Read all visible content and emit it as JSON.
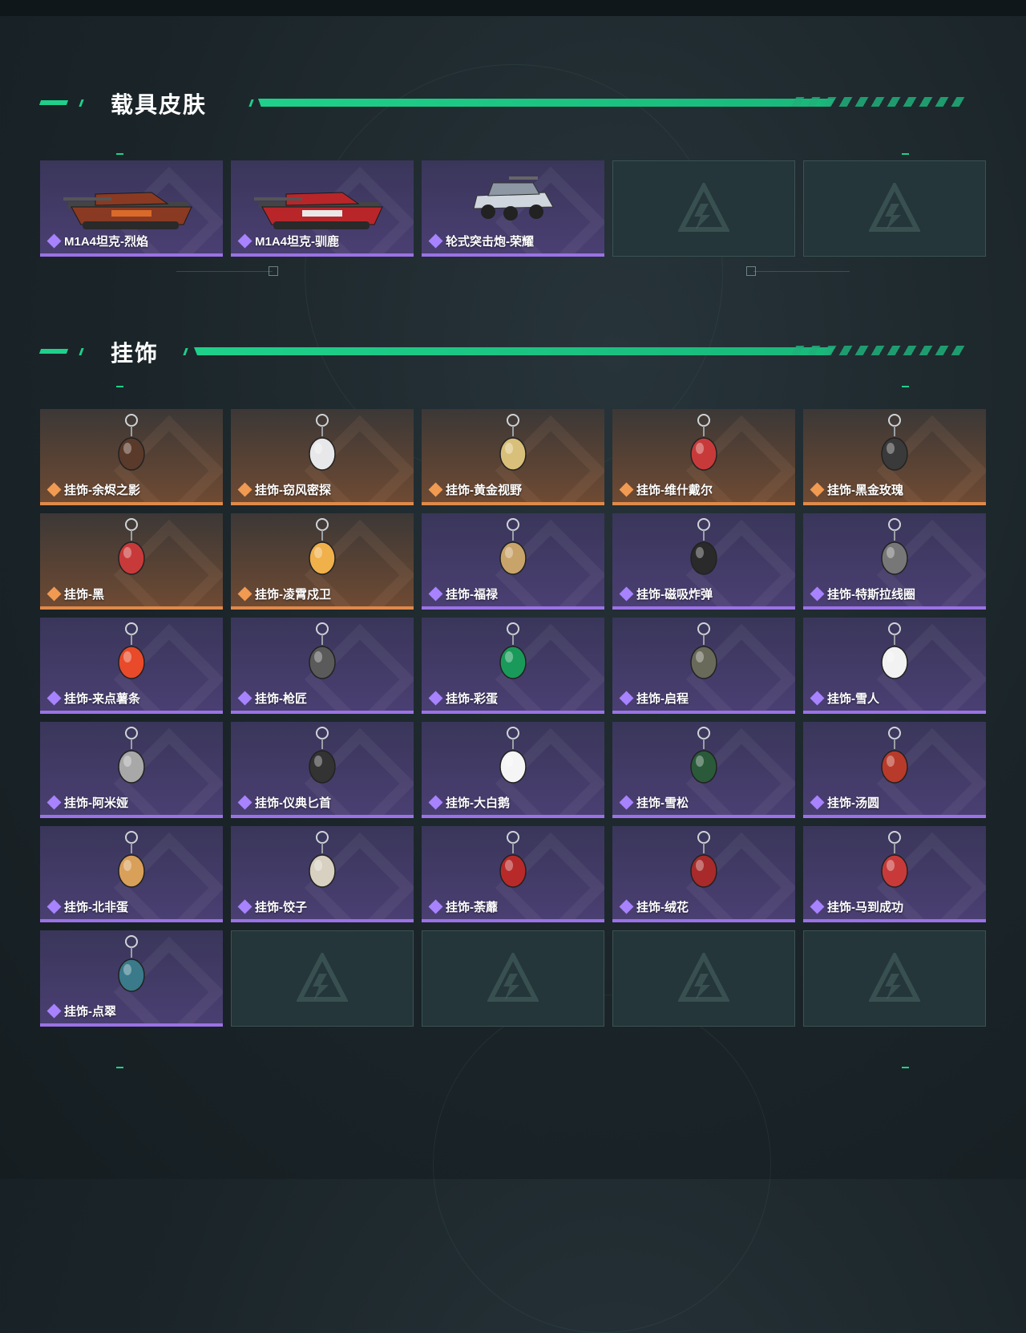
{
  "sections": {
    "vehicle_skins": {
      "title": "载具皮肤",
      "items": [
        {
          "label": "M1A4坦克-烈焰",
          "rarity": "purple",
          "icon": "tank-flame-icon"
        },
        {
          "label": "M1A4坦克-驯鹿",
          "rarity": "purple",
          "icon": "tank-reindeer-icon"
        },
        {
          "label": "轮式突击炮-荣耀",
          "rarity": "purple",
          "icon": "wheeled-assault-gun-icon"
        }
      ]
    },
    "charms": {
      "title": "挂饰",
      "items": [
        {
          "label": "挂饰-余烬之影",
          "rarity": "orange",
          "icon": "ember-shadow-charm-icon"
        },
        {
          "label": "挂饰-窃风密探",
          "rarity": "orange",
          "icon": "wind-spy-charm-icon"
        },
        {
          "label": "挂饰-黄金视野",
          "rarity": "orange",
          "icon": "golden-vision-charm-icon"
        },
        {
          "label": "挂饰-维什戴尔",
          "rarity": "orange",
          "icon": "wisdel-charm-icon"
        },
        {
          "label": "挂饰-黑金玫瑰",
          "rarity": "orange",
          "icon": "black-gold-rose-charm-icon"
        },
        {
          "label": "挂饰-黑",
          "rarity": "orange",
          "icon": "hei-charm-icon"
        },
        {
          "label": "挂饰-凌霄戍卫",
          "rarity": "orange",
          "icon": "sky-guard-charm-icon"
        },
        {
          "label": "挂饰-福禄",
          "rarity": "purple",
          "icon": "fortune-gourd-charm-icon"
        },
        {
          "label": "挂饰-磁吸炸弹",
          "rarity": "purple",
          "icon": "magnetic-bomb-charm-icon"
        },
        {
          "label": "挂饰-特斯拉线圈",
          "rarity": "purple",
          "icon": "tesla-coil-charm-icon"
        },
        {
          "label": "挂饰-来点薯条",
          "rarity": "purple",
          "icon": "fries-charm-icon"
        },
        {
          "label": "挂饰-枪匠",
          "rarity": "purple",
          "icon": "gunsmith-charm-icon"
        },
        {
          "label": "挂饰-彩蛋",
          "rarity": "purple",
          "icon": "easter-egg-charm-icon"
        },
        {
          "label": "挂饰-启程",
          "rarity": "purple",
          "icon": "departure-charm-icon"
        },
        {
          "label": "挂饰-雪人",
          "rarity": "purple",
          "icon": "snowman-charm-icon"
        },
        {
          "label": "挂饰-阿米娅",
          "rarity": "purple",
          "icon": "amiya-charm-icon"
        },
        {
          "label": "挂饰-仪典匕首",
          "rarity": "purple",
          "icon": "ceremonial-dagger-charm-icon"
        },
        {
          "label": "挂饰-大白鹅",
          "rarity": "purple",
          "icon": "white-goose-charm-icon"
        },
        {
          "label": "挂饰-雪松",
          "rarity": "purple",
          "icon": "snow-pine-charm-icon"
        },
        {
          "label": "挂饰-汤圆",
          "rarity": "purple",
          "icon": "tangyuan-charm-icon"
        },
        {
          "label": "挂饰-北非蛋",
          "rarity": "purple",
          "icon": "shakshuka-charm-icon"
        },
        {
          "label": "挂饰-饺子",
          "rarity": "purple",
          "icon": "dumpling-charm-icon"
        },
        {
          "label": "挂饰-荼蘼",
          "rarity": "purple",
          "icon": "rose-bloom-charm-icon"
        },
        {
          "label": "挂饰-绒花",
          "rarity": "purple",
          "icon": "velvet-flower-charm-icon"
        },
        {
          "label": "挂饰-马到成功",
          "rarity": "purple",
          "icon": "horse-success-charm-icon"
        },
        {
          "label": "挂饰-点翠",
          "rarity": "purple",
          "icon": "kingfisher-charm-icon"
        }
      ]
    }
  },
  "colors": {
    "accent": "#1fd08a",
    "purple_rarity": "#9b72e6",
    "orange_rarity": "#e0894a",
    "empty_slot": "#24363a"
  }
}
